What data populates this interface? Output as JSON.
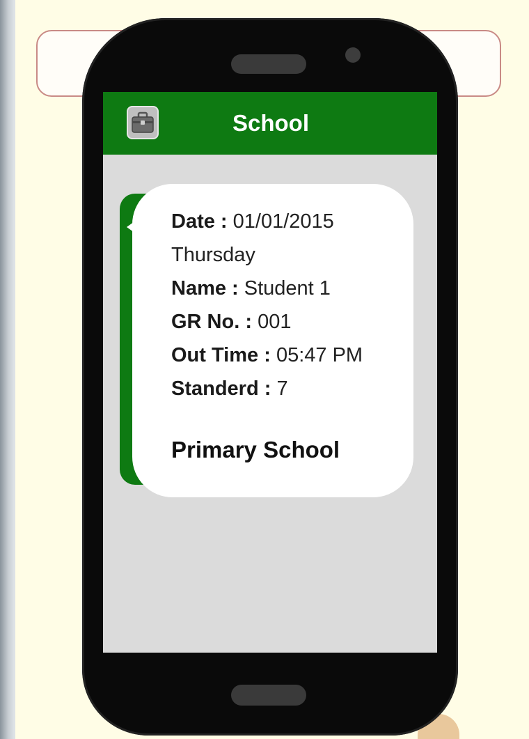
{
  "app": {
    "title": "School",
    "icon": "school-bag-icon",
    "accent_color": "#0e7a12"
  },
  "notification": {
    "date_label": "Date :",
    "date_value": "01/01/2015",
    "day": "Thursday",
    "name_label": "Name :",
    "name_value": "Student 1",
    "gr_label": "GR No. :",
    "gr_value": "001",
    "out_time_label": "Out Time :",
    "out_time_value": "05:47 PM",
    "standard_label": "Standerd :",
    "standard_value": "7",
    "school_name": "Primary School"
  }
}
